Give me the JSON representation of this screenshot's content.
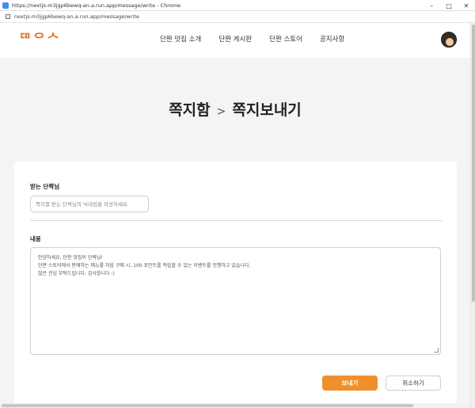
{
  "window": {
    "title": "https://nextjs-m3jgp6bewq-an.a.run.app/message/write - Chrome",
    "controls": {
      "minimize": "–",
      "maximize": "□",
      "close": "✕"
    }
  },
  "address": {
    "url": "nextjs-m3jgp6bewq-an.a.run.app/message/write"
  },
  "header": {
    "logo_text": "ᄃᄆᄋᄉ",
    "nav": [
      "단짠 맛집 소개",
      "단짠 게시판",
      "단짠 스토어",
      "공지사항"
    ]
  },
  "page": {
    "breadcrumb_parent": "쪽지함",
    "breadcrumb_separator": ">",
    "breadcrumb_current": "쪽지보내기"
  },
  "form": {
    "recipient_label": "받는 단짝님",
    "recipient_placeholder": "쪽지를 받는 단짝님의 닉네임을 작성하세요.",
    "content_label": "내용",
    "content_lines": [
      "안녕하세요, 단짠 맛집의 단짝님!",
      "단짠 스토어에서 판매하는 메뉴를 처음 구매 시, 100 포인트를 적립할 수 있는 이벤트를 진행하고 있습니다.",
      "많은 관심 부탁드립니다. 감사합니다 :)"
    ],
    "send_label": "보내기",
    "cancel_label": "취소하기"
  },
  "colors": {
    "accent": "#f0902a",
    "logo": "#e8762a"
  }
}
